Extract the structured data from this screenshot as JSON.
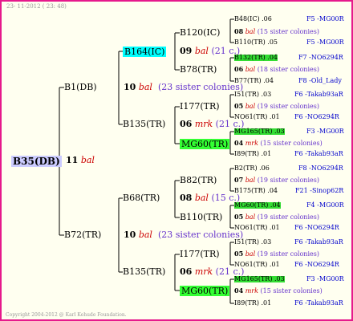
{
  "header": {
    "date": "23- 11-2012 ( 23: 48)"
  },
  "copyright": "Copyright 2004-2012 @ Karl Kehude Foundation.",
  "root": {
    "label": "B35(DB)",
    "colony_num": "11",
    "colony_word": "bal"
  },
  "gen1": [
    {
      "label": "B1(DB)",
      "colony_num": "10",
      "colony_word": "bal",
      "sisters": "(23 sister colonies)"
    },
    {
      "label": "B72(TR)",
      "colony_num": "10",
      "colony_word": "bal",
      "sisters": "(23 sister colonies)"
    }
  ],
  "gen2": [
    {
      "label": "B164(IC)",
      "colony_num": "09",
      "colony_word": "bal",
      "sisters": "(21 c.)"
    },
    {
      "label": "B135(TR)",
      "colony_num": "06",
      "colony_word": "mrk",
      "sisters": "(21 c.)"
    },
    {
      "label": "B68(TR)",
      "colony_num": "08",
      "colony_word": "bal",
      "sisters": "(15 c.)"
    },
    {
      "label": "B135(TR)",
      "colony_num": "06",
      "colony_word": "mrk",
      "sisters": "(21 c.)"
    }
  ],
  "gen3": [
    {
      "label": "B120(IC)",
      "colony_num": "08",
      "colony_word": "bal",
      "sisters": "(15 sister colonies)"
    },
    {
      "label": "B78(TR)",
      "colony_num": "06",
      "colony_word": "bal",
      "sisters": "(18 sister colonies)"
    },
    {
      "label": "I177(TR)",
      "colony_num": "05",
      "colony_word": "bal",
      "sisters": "(19 sister colonies)"
    },
    {
      "label": "MG60(TR)",
      "colony_num": "04",
      "colony_word": "mrk",
      "sisters": "(15 sister colonies)"
    },
    {
      "label": "B82(TR)",
      "colony_num": "07",
      "colony_word": "bal",
      "sisters": "(19 sister colonies)"
    },
    {
      "label": "B110(TR)",
      "colony_num": "05",
      "colony_word": "bal",
      "sisters": "(19 sister colonies)"
    },
    {
      "label": "I177(TR)",
      "colony_num": "05",
      "colony_word": "bal",
      "sisters": "(19 sister colonies)"
    },
    {
      "label": "MG60(TR)",
      "colony_num": "04",
      "colony_word": "mrk",
      "sisters": "(15 sister colonies)"
    }
  ],
  "gen4": [
    {
      "label": "B48(IC)",
      "val": ".06",
      "line": "F5 -MG00R"
    },
    {
      "label": "B110(TR)",
      "val": ".05",
      "line": "F5 -MG00R"
    },
    {
      "label": "B132(TR)",
      "val": ".04",
      "line": "F7 -NO6294R"
    },
    {
      "label": "B77(TR)",
      "val": ".04",
      "line": "F8 -Old_Lady"
    },
    {
      "label": "I51(TR)",
      "val": ".03",
      "line": "F6 -Takab93aR"
    },
    {
      "label": "NO61(TR)",
      "val": ".01",
      "line": "F6 -NO6294R"
    },
    {
      "label": "MG165(TR)",
      "val": ".03",
      "line": "F3 -MG00R"
    },
    {
      "label": "I89(TR)",
      "val": ".01",
      "line": "F6 -Takab93aR"
    },
    {
      "label": "B2(TR)",
      "val": ".06",
      "line": "F8 -NO6294R"
    },
    {
      "label": "B175(TR)",
      "val": ".04",
      "line": "F21 -Sinop62R"
    },
    {
      "label": "MG60(TR)",
      "val": ".04",
      "line": "F4 -MG00R"
    },
    {
      "label": "NO61(TR)",
      "val": ".01",
      "line": "F6 -NO6294R"
    },
    {
      "label": "I51(TR)",
      "val": ".03",
      "line": "F6 -Takab93aR"
    },
    {
      "label": "NO61(TR)",
      "val": ".01",
      "line": "F6 -NO6294R"
    },
    {
      "label": "MG165(TR)",
      "val": ".03",
      "line": "F3 -MG00R"
    },
    {
      "label": "I89(TR)",
      "val": ".01",
      "line": "F6 -Takab93aR"
    }
  ],
  "colors": {
    "border": "#e6198c",
    "bg": "#fffff0",
    "highlight_cyan": "#00ffff",
    "highlight_green": "#33ff33",
    "line_color": "#0000cc",
    "bal_color": "#cc0000"
  }
}
